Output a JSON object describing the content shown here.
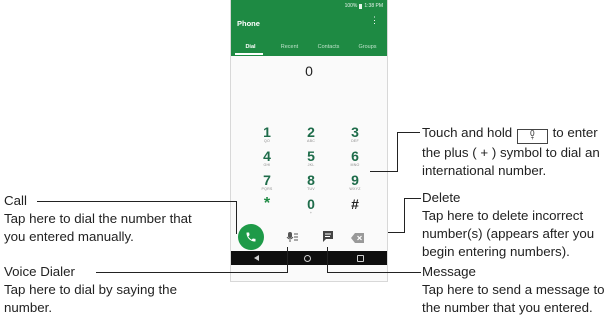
{
  "phone": {
    "status_bar": {
      "battery": "100%",
      "time": "1:38 PM"
    },
    "app_title": "Phone",
    "menu_icon": "more-vert-icon",
    "tabs": [
      {
        "label": "Dial",
        "active": true
      },
      {
        "label": "Recent",
        "active": false
      },
      {
        "label": "Contacts",
        "active": false
      },
      {
        "label": "Groups",
        "active": false
      }
    ],
    "display_number": "0",
    "keypad": [
      {
        "digit": "1",
        "letters": "QO"
      },
      {
        "digit": "2",
        "letters": "ABC"
      },
      {
        "digit": "3",
        "letters": "DEF"
      },
      {
        "digit": "4",
        "letters": "GHI"
      },
      {
        "digit": "5",
        "letters": "JKL"
      },
      {
        "digit": "6",
        "letters": "MNO"
      },
      {
        "digit": "7",
        "letters": "PQRS"
      },
      {
        "digit": "8",
        "letters": "TUV"
      },
      {
        "digit": "9",
        "letters": "WXYZ"
      },
      {
        "digit": "*",
        "letters": ""
      },
      {
        "digit": "0",
        "letters": "+"
      },
      {
        "digit": "#",
        "letters": ""
      }
    ],
    "colors": {
      "appbar": "#1e8a43",
      "call_button": "#1e9a48",
      "keypad_digit": "#1e6c4a",
      "navbar": "#0e0e0e"
    }
  },
  "callouts": {
    "plus": {
      "line1_before": "Touch and hold",
      "key_digit": "0",
      "key_sub": "+",
      "line1_after": "to enter",
      "line2": "the plus ( + ) symbol to dial an",
      "line3": "international number."
    },
    "call": {
      "title": "Call",
      "desc1": "Tap here to dial the number that",
      "desc2": "you entered manually."
    },
    "delete": {
      "title": "Delete",
      "desc1": "Tap here to delete incorrect",
      "desc2": "number(s) (appears after you",
      "desc3": "begin entering numbers)."
    },
    "voice": {
      "title": "Voice Dialer",
      "desc1": "Tap here to dial by saying the",
      "desc2": "number."
    },
    "message": {
      "title": "Message",
      "desc1": "Tap here to send a message to",
      "desc2": "the number that you entered."
    }
  }
}
